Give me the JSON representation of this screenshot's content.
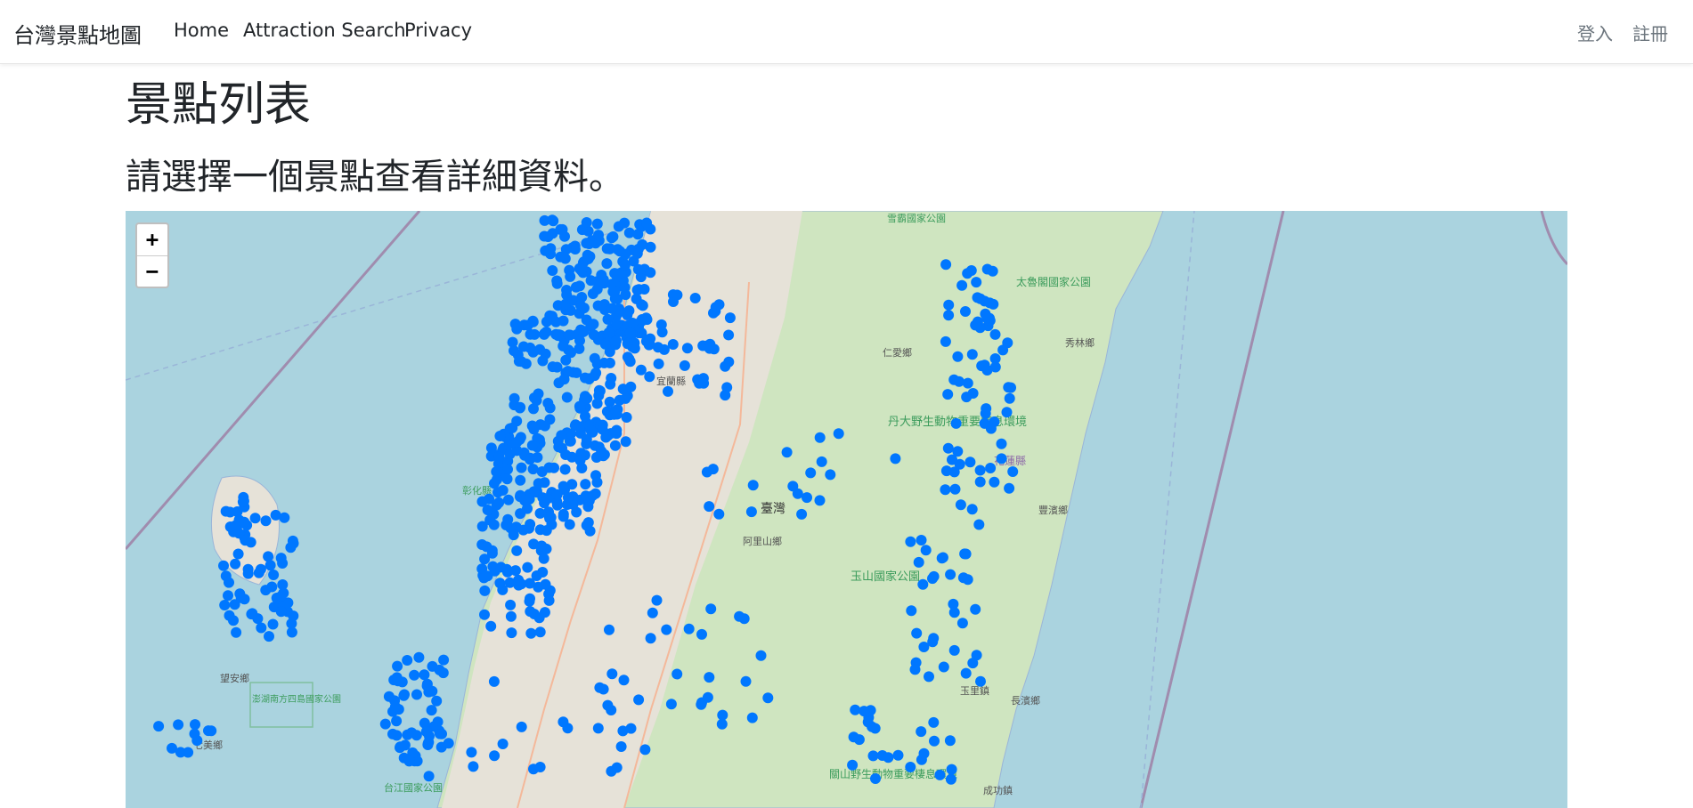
{
  "navbar": {
    "brand": "台灣景點地圖",
    "links": [
      "Home",
      "Attraction Search",
      "Privacy"
    ],
    "login": "登入",
    "register": "註冊"
  },
  "page": {
    "title": "景點列表",
    "subtitle": "請選擇一個景點查看詳細資料。"
  },
  "map": {
    "zoom_in": "+",
    "zoom_out": "−",
    "marker_color": "#0077ff",
    "sea_color": "#aad3df",
    "land_color": "#c8e0b4",
    "urban_color": "#e8e4dc",
    "labels": {
      "yilan": "宜蘭縣",
      "renai": "仁愛鄉",
      "danta": "丹大野生動物重要棲息環境",
      "hualien": "花蓮縣",
      "fengbin": "豐濱鄉",
      "yushan": "玉山國家公園",
      "ali": "阿里山鄉",
      "changhua": "彰化縣",
      "taiwan": "臺灣",
      "wangan": "望安鄉",
      "qimei": "七美鄉",
      "penghu_park": "澎湖南方四島國家公園",
      "taijiang": "台江國家公園",
      "xuebao": "雪霸國家公園",
      "taroko": "太魯閣國家公園",
      "xiulin": "秀林鄉",
      "yuli": "玉里鎮",
      "changbin": "長濱鄉",
      "chenggong": "成功鎮",
      "guanshan": "關山野生動物重要棲息環境"
    }
  }
}
